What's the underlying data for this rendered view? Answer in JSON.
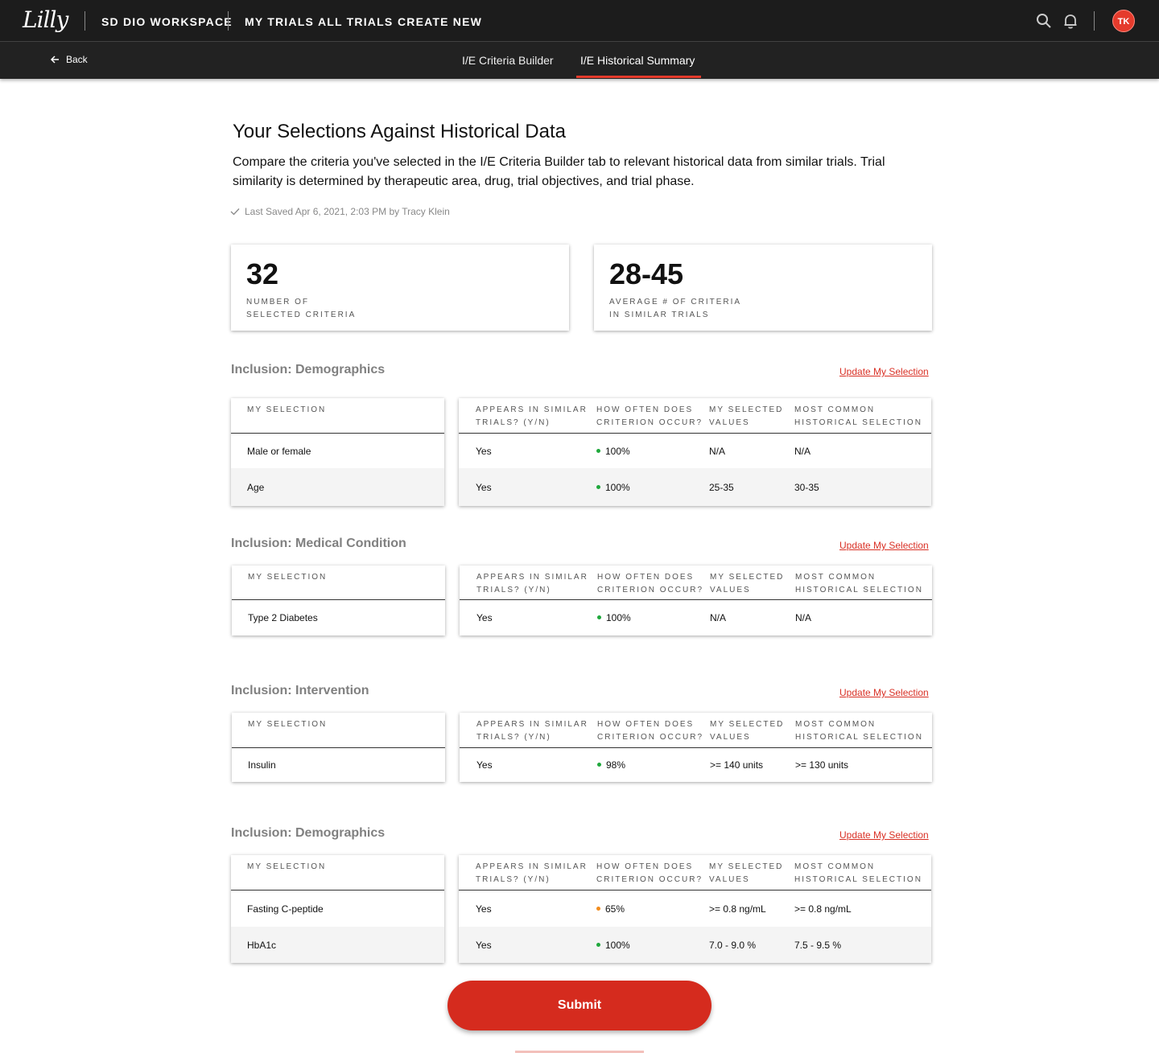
{
  "header": {
    "logo": "Lilly",
    "workspace": "SD DIO WORKSPACE",
    "nav": [
      "MY TRIALS",
      "ALL TRIALS",
      "CREATE NEW"
    ],
    "avatar_initials": "TK",
    "icons": [
      "search-icon",
      "bell-icon"
    ]
  },
  "subnav": {
    "back_label": "Back",
    "tabs": [
      "I/E Criteria Builder",
      "I/E Historical Summary"
    ],
    "active_tab": "I/E Historical Summary"
  },
  "page": {
    "title": "Your Selections Against Historical Data",
    "description": "Compare the criteria you've selected in the I/E Criteria Builder tab to relevant historical data from similar trials. Trial similarity is determined by therapeutic area, drug, trial objectives, and trial phase.",
    "saved": "Last Saved Apr 6, 2021, 2:03 PM by Tracy Klein"
  },
  "stats": [
    {
      "value": "32",
      "label_line1": "NUMBER OF",
      "label_line2": "SELECTED CRITERIA"
    },
    {
      "value": "28-45",
      "label_line1": "AVERAGE # OF CRITERIA",
      "label_line2": "IN SIMILAR TRIALS"
    }
  ],
  "columns": {
    "my_selection": "MY SELECTION",
    "appears_l1": "APPEARS IN SIMILAR",
    "appears_l2": "TRIALS? (Y/N)",
    "how_often_l1": "HOW OFTEN DOES",
    "how_often_l2": "CRITERION OCCUR?",
    "selected_l1": "MY SELECTED",
    "selected_l2": "VALUES",
    "common_l1": "MOST COMMON",
    "common_l2": "HISTORICAL SELECTION"
  },
  "update_link": "Update My Selection",
  "colors": {
    "green": "#1fa83c",
    "orange": "#f28c1c",
    "accent": "#d52b1e"
  },
  "sections": [
    {
      "title": "Inclusion: Demographics",
      "rows": [
        {
          "selection": "Male or female",
          "appears": "Yes",
          "how_often": "100%",
          "status": "green",
          "selected": "N/A",
          "common": "N/A"
        },
        {
          "selection": "Age",
          "appears": "Yes",
          "how_often": "100%",
          "status": "green",
          "selected": "25-35",
          "common": "30-35"
        }
      ]
    },
    {
      "title": "Inclusion: Medical Condition",
      "rows": [
        {
          "selection": "Type 2 Diabetes",
          "appears": "Yes",
          "how_often": "100%",
          "status": "green",
          "selected": "N/A",
          "common": "N/A"
        }
      ]
    },
    {
      "title": "Inclusion: Intervention",
      "rows": [
        {
          "selection": "Insulin",
          "appears": "Yes",
          "how_often": "98%",
          "status": "green",
          "selected": ">= 140 units",
          "common": ">= 130 units"
        }
      ]
    },
    {
      "title": "Inclusion: Demographics",
      "rows": [
        {
          "selection": "Fasting C-peptide",
          "appears": "Yes",
          "how_often": "65%",
          "status": "orange",
          "selected": ">= 0.8 ng/mL",
          "common": ">= 0.8 ng/mL"
        },
        {
          "selection": "HbA1c",
          "appears": "Yes",
          "how_often": "100%",
          "status": "green",
          "selected": "7.0 - 9.0 %",
          "common": "7.5 - 9.5 %"
        }
      ]
    }
  ],
  "submit_label": "Submit"
}
